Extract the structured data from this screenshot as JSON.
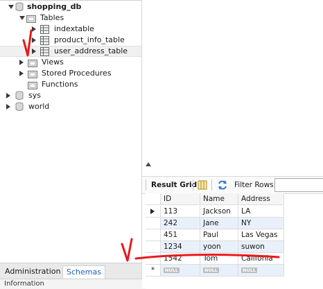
{
  "navigator": {
    "schema_name": "shopping_db",
    "tables_folder": "Tables",
    "tables": [
      "indextable",
      "product_info_table",
      "user_address_table"
    ],
    "views_folder": "Views",
    "procedures_folder": "Stored Procedures",
    "functions_folder": "Functions",
    "other_schemas": [
      "sys",
      "world"
    ]
  },
  "bottom_tabs": {
    "administration": "Administration",
    "schemas": "Schemas"
  },
  "info_panel": {
    "label": "Information"
  },
  "result_toolbar": {
    "result_grid_label": "Result Grid",
    "filter_rows_label": "Filter Rows:"
  },
  "grid": {
    "columns": [
      "ID",
      "Name",
      "Address"
    ],
    "rows": [
      [
        "113",
        "Jackson",
        "LA"
      ],
      [
        "242",
        "Jane",
        "NY"
      ],
      [
        "451",
        "Paul",
        "Las Vegas"
      ],
      [
        "1234",
        "yoon",
        "suwon"
      ],
      [
        "1542",
        "Tom",
        "Califonia"
      ]
    ],
    "null_badge": "NULL"
  },
  "annotation_color": "#e8191b"
}
